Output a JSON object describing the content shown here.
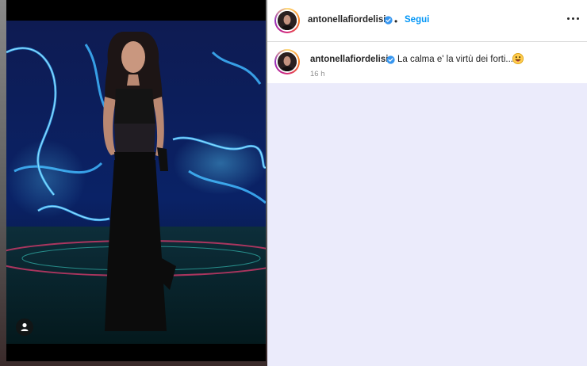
{
  "post": {
    "username": "antonellafiordelisi",
    "follow_label": "Segui",
    "dot": "•",
    "caption_text": "La calma e' la virtù dei forti...",
    "time_ago": "16 h",
    "emoji_icon": "grinning-tongue-emoji",
    "verified_color": "#3897f0",
    "follow_color": "#0095f6"
  }
}
